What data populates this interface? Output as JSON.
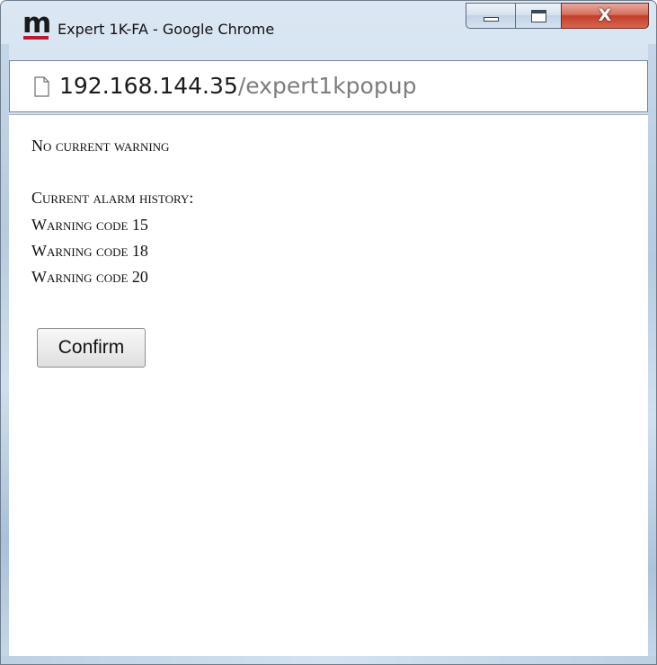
{
  "window": {
    "title": "Expert 1K-FA - Google Chrome",
    "app_icon": "m-logo-icon",
    "controls": {
      "minimize": "minimize-icon",
      "maximize": "maximize-icon",
      "close_glyph": "X"
    }
  },
  "address_bar": {
    "page_icon": "page-icon",
    "host": "192.168.144.35",
    "path": "/expert1kpopup"
  },
  "content": {
    "current_warning": "No current warning",
    "history_title": "Current alarm history:",
    "history": [
      "Warning code 15",
      "Warning code 18",
      "Warning code 20"
    ],
    "confirm_label": "Confirm"
  },
  "colors": {
    "logo_accent": "#c0172c",
    "close_button": "#c23e2a",
    "url_path": "#7d7d7d"
  }
}
